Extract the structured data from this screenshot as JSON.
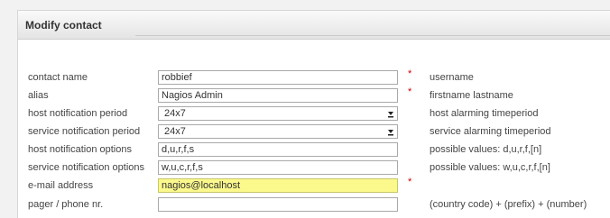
{
  "panel": {
    "title": "Modify contact"
  },
  "required_marker": "*",
  "rows": [
    {
      "label": "contact name",
      "value": "robbief",
      "required": true,
      "hint": "username"
    },
    {
      "label": "alias",
      "value": "Nagios Admin",
      "required": true,
      "hint": "firstname lastname"
    },
    {
      "label": "host notification period",
      "value": "24x7",
      "hint": "host alarming timeperiod"
    },
    {
      "label": "service notification period",
      "value": "24x7",
      "hint": "service alarming timeperiod"
    },
    {
      "label": "host notification options",
      "value": "d,u,r,f,s",
      "hint": "possible values: d,u,r,f,[n]"
    },
    {
      "label": "service notification options",
      "value": "w,u,c,r,f,s",
      "hint": "possible values: w,u,c,r,f,[n]"
    },
    {
      "label": "e-mail address",
      "value": "nagios@localhost",
      "required": true,
      "hint": ""
    },
    {
      "label": "pager / phone nr.",
      "value": "",
      "hint": "(country code) + (prefix) + (number)"
    }
  ],
  "colors": {
    "highlight": "#fbf88c",
    "required": "#d40000"
  }
}
